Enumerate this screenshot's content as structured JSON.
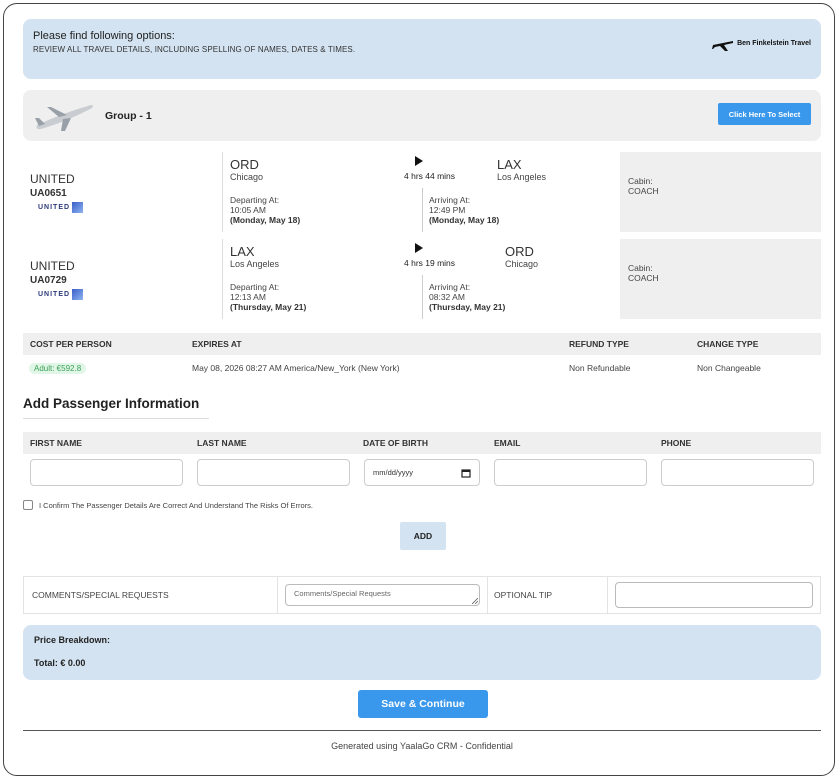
{
  "header": {
    "title": "Please find following options:",
    "subtitle": "REVIEW ALL TRAVEL DETAILS, INCLUDING SPELLING OF NAMES, DATES & TIMES.",
    "logo_text": "Ben Finkelstein Travel"
  },
  "group": {
    "title": "Group - 1",
    "select_label": "Click Here To Select"
  },
  "segments": [
    {
      "airline": "UNITED",
      "flight": "UA0651",
      "airline_logo": "UNITED",
      "origin_code": "ORD",
      "origin_city": "Chicago",
      "duration": "4 hrs 44 mins",
      "dest_code": "LAX",
      "dest_city": "Los Angeles",
      "depart_label": "Departing At:",
      "depart_time": "10:05 AM",
      "depart_date": "(Monday, May 18)",
      "arrive_label": "Arriving At:",
      "arrive_time": "12:49 PM",
      "arrive_date": "(Monday, May 18)",
      "cabin_label": "Cabin:",
      "cabin": "COACH"
    },
    {
      "airline": "UNITED",
      "flight": "UA0729",
      "airline_logo": "UNITED",
      "origin_code": "LAX",
      "origin_city": "Los Angeles",
      "duration": "4 hrs 19 mins",
      "dest_code": "ORD",
      "dest_city": "Chicago",
      "depart_label": "Departing At:",
      "depart_time": "12:13 AM",
      "depart_date": "(Thursday, May 21)",
      "arrive_label": "Arriving At:",
      "arrive_time": "08:32 AM",
      "arrive_date": "(Thursday, May 21)",
      "cabin_label": "Cabin:",
      "cabin": "COACH"
    }
  ],
  "cost": {
    "headers": [
      "COST PER PERSON",
      "EXPIRES AT",
      "REFUND TYPE",
      "CHANGE TYPE"
    ],
    "adult_badge": "Adult: €592.8",
    "expires": "May 08, 2026 08:27 AM America/New_York (New York)",
    "refund": "Non Refundable",
    "change": "Non Changeable"
  },
  "passenger": {
    "title": "Add Passenger Information",
    "headers": [
      "FIRST NAME",
      "LAST NAME",
      "DATE OF BIRTH",
      "EMAIL",
      "PHONE"
    ],
    "dob_placeholder": "mm/dd/yyyy",
    "confirm_text": "I Confirm The Passenger Details Are Correct And Understand The Risks Of Errors.",
    "add_label": "ADD"
  },
  "comments": {
    "label": "COMMENTS/SPECIAL REQUESTS",
    "placeholder": "Comments/Special Requests",
    "tip_label": "OPTIONAL TIP"
  },
  "price": {
    "title": "Price Breakdown:",
    "total_label": "Total:",
    "total_value": "€ 0.00"
  },
  "save_label": "Save & Continue",
  "footer": "Generated using YaalaGo CRM - Confidential",
  "colors": {
    "accent": "#3a98ec",
    "banner_bg": "#d3e3f1",
    "row_bg": "#efefef"
  }
}
